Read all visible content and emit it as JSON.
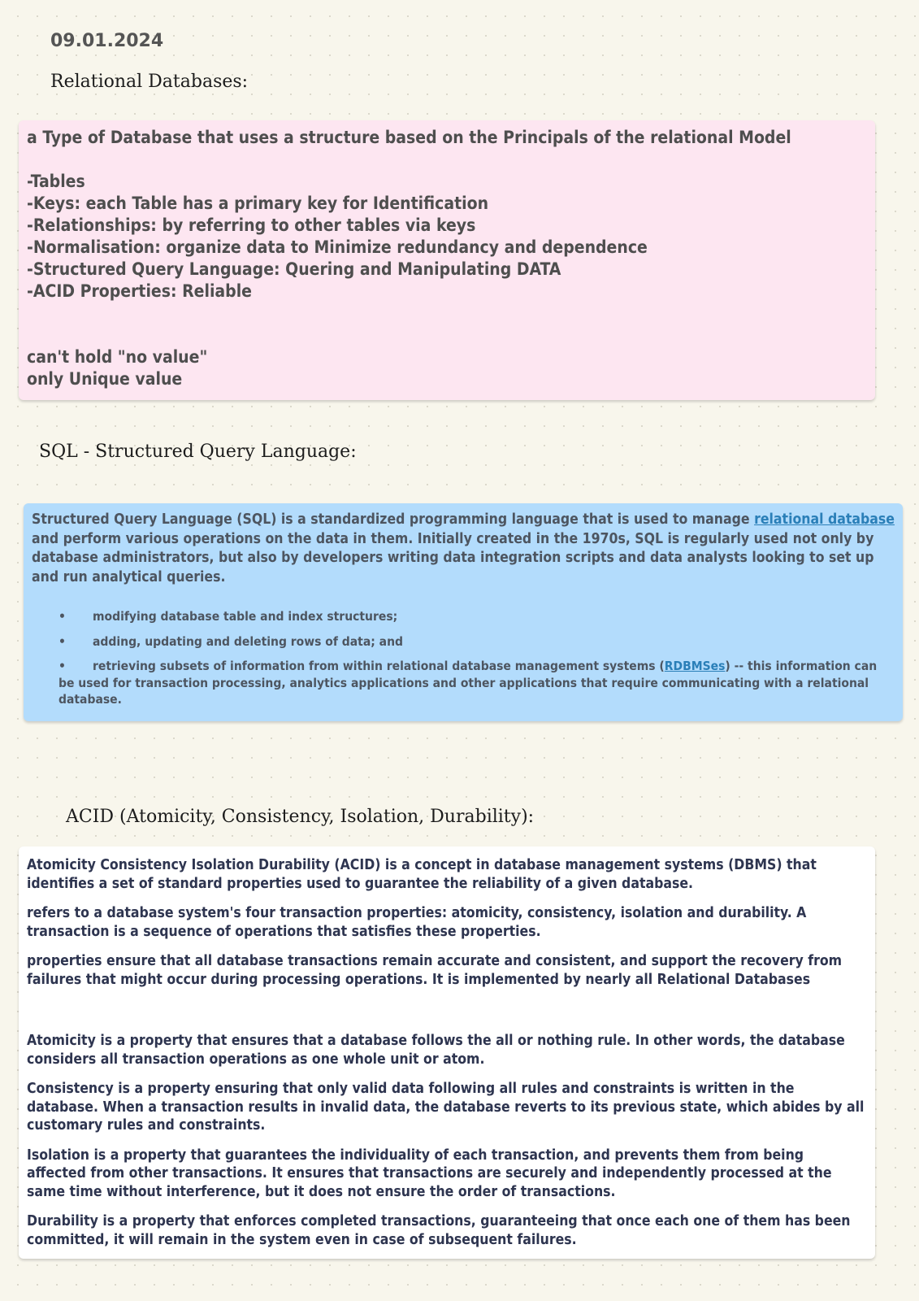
{
  "date": "09.01.2024",
  "sections": {
    "relational": {
      "heading": "Relational Databases:",
      "intro": "a Type of Database that uses a structure based on the Principals of the relational Model",
      "items": [
        "-Tables",
        "-Keys: each Table has a primary key for Identification",
        "-Relationships: by referring to other tables via keys",
        "-Normalisation: organize data to Minimize redundancy and dependence",
        "-Structured Query Language: Quering and Manipulating DATA",
        "-ACID Properties: Reliable"
      ],
      "notes": [
        "can't hold \"no value\"",
        "only Unique value"
      ],
      "color": "#fde6f1"
    },
    "sql": {
      "heading": "SQL - Structured Query Language:",
      "para_before_link": "Structured Query Language (SQL) is a standardized programming language that is used to manage ",
      "para_link": "relational database",
      "para_after_link": " and perform various operations on the data in them. Initially created in the 1970s, SQL is regularly used not only by database administrators, but also by developers writing data integration scripts and data analysts looking to set up and run analytical queries.",
      "bullets": {
        "b1": "modifying database table and index structures;",
        "b2": "adding, updating and deleting rows of data; and",
        "b3_before": "retrieving subsets of information from within relational database management systems (",
        "b3_link": "RDBMSes",
        "b3_after": ") -- this information can be used for transaction processing, analytics applications and other applications that require communicating with a relational database."
      },
      "bullet_glyph": "•",
      "color": "#b3dcfc",
      "link_color": "#2a7fb8"
    },
    "acid": {
      "heading": "ACID (Atomicity, Consistency, Isolation, Durability):",
      "paragraphs": [
        "Atomicity Consistency Isolation Durability (ACID) is a concept in database management systems (DBMS) that identifies a set of standard properties used to guarantee the reliability of a given database.",
        "refers to a database system's four transaction properties: atomicity, consistency, isolation and durability. A transaction is a sequence of operations that satisfies these properties.",
        "properties ensure that all database transactions remain accurate and consistent, and support the recovery from failures that might occur during processing operations. It is implemented by nearly all Relational Databases"
      ],
      "properties": [
        "Atomicity is a property that ensures that a database follows the all or nothing rule. In other words, the database considers all transaction operations as one whole unit or atom.",
        "Consistency is a property ensuring that only valid data following all rules and constraints is written in the database. When a transaction results in invalid data, the database reverts to its previous state, which abides by all customary rules and constraints.",
        "Isolation is a property that guarantees the individuality of each transaction, and prevents them from being affected from other transactions. It ensures that transactions are securely and independently processed at the same time without interference, but it does not ensure the order of transactions.",
        "Durability is a property that enforces completed transactions, guaranteeing that once each one of them has been committed, it will remain in the system even in case of subsequent failures."
      ],
      "color": "#ffffff"
    }
  }
}
